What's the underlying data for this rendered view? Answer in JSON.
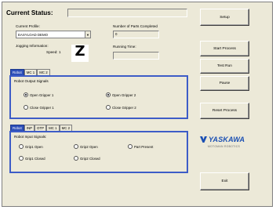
{
  "header": {
    "status_label": "Current Status:",
    "status_value": ""
  },
  "profile": {
    "label": "Current Profile:",
    "selected": "EASYLOAD DEMO",
    "jogging_label": "Jogging Information:",
    "speed_label": "Speed:",
    "speed_value": "1",
    "jog_indicator": "Z"
  },
  "parts": {
    "label": "Number of Parts Completed",
    "value": "0"
  },
  "running_time": {
    "label": "Running Time:",
    "value": ""
  },
  "buttons": {
    "setup": "Setup",
    "start_process": "Start Process",
    "test_run": "Test Run",
    "pause": "Pause",
    "reset_process": "Reset Process",
    "exit": "Exit"
  },
  "output_panel": {
    "tabs": [
      "Robot",
      "MC 1",
      "MC 2"
    ],
    "active_tab": 0,
    "title": "Robot Output Signals",
    "signals": [
      {
        "label": "Open Gripper 1",
        "checked": true
      },
      {
        "label": "Open Gripper 2",
        "checked": true
      },
      {
        "label": "Close Gripper 1",
        "checked": false
      },
      {
        "label": "Close Gripper 2",
        "checked": false
      }
    ]
  },
  "input_panel": {
    "tabs": [
      "Robot",
      "INP",
      "OTP",
      "MC 1",
      "MC 2"
    ],
    "active_tab": 0,
    "title": "Robot Input Signals:",
    "signals": [
      {
        "label": "Grip1 Open",
        "checked": false
      },
      {
        "label": "Grip2 Open",
        "checked": false
      },
      {
        "label": "Part Present",
        "checked": false
      },
      {
        "label": "Grip1 Closed",
        "checked": false
      },
      {
        "label": "Grip2 Closed",
        "checked": false
      }
    ]
  },
  "brand": {
    "name": "YASKAWA",
    "subtitle": "MOTOMAN ROBOTICS",
    "color": "#1a4fb3"
  },
  "colors": {
    "tab_active": "#2d4fb8",
    "group_border": "#3d5cc7",
    "window_bg": "#ece9d8"
  }
}
